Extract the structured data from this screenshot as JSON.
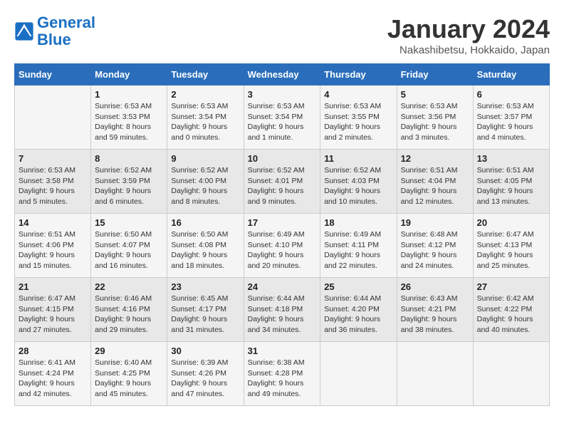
{
  "header": {
    "logo_line1": "General",
    "logo_line2": "Blue",
    "month": "January 2024",
    "location": "Nakashibetsu, Hokkaido, Japan"
  },
  "days_of_week": [
    "Sunday",
    "Monday",
    "Tuesday",
    "Wednesday",
    "Thursday",
    "Friday",
    "Saturday"
  ],
  "weeks": [
    [
      {
        "day": "",
        "info": ""
      },
      {
        "day": "1",
        "info": "Sunrise: 6:53 AM\nSunset: 3:53 PM\nDaylight: 8 hours\nand 59 minutes."
      },
      {
        "day": "2",
        "info": "Sunrise: 6:53 AM\nSunset: 3:54 PM\nDaylight: 9 hours\nand 0 minutes."
      },
      {
        "day": "3",
        "info": "Sunrise: 6:53 AM\nSunset: 3:54 PM\nDaylight: 9 hours\nand 1 minute."
      },
      {
        "day": "4",
        "info": "Sunrise: 6:53 AM\nSunset: 3:55 PM\nDaylight: 9 hours\nand 2 minutes."
      },
      {
        "day": "5",
        "info": "Sunrise: 6:53 AM\nSunset: 3:56 PM\nDaylight: 9 hours\nand 3 minutes."
      },
      {
        "day": "6",
        "info": "Sunrise: 6:53 AM\nSunset: 3:57 PM\nDaylight: 9 hours\nand 4 minutes."
      }
    ],
    [
      {
        "day": "7",
        "info": "Sunrise: 6:53 AM\nSunset: 3:58 PM\nDaylight: 9 hours\nand 5 minutes."
      },
      {
        "day": "8",
        "info": "Sunrise: 6:52 AM\nSunset: 3:59 PM\nDaylight: 9 hours\nand 6 minutes."
      },
      {
        "day": "9",
        "info": "Sunrise: 6:52 AM\nSunset: 4:00 PM\nDaylight: 9 hours\nand 8 minutes."
      },
      {
        "day": "10",
        "info": "Sunrise: 6:52 AM\nSunset: 4:01 PM\nDaylight: 9 hours\nand 9 minutes."
      },
      {
        "day": "11",
        "info": "Sunrise: 6:52 AM\nSunset: 4:03 PM\nDaylight: 9 hours\nand 10 minutes."
      },
      {
        "day": "12",
        "info": "Sunrise: 6:51 AM\nSunset: 4:04 PM\nDaylight: 9 hours\nand 12 minutes."
      },
      {
        "day": "13",
        "info": "Sunrise: 6:51 AM\nSunset: 4:05 PM\nDaylight: 9 hours\nand 13 minutes."
      }
    ],
    [
      {
        "day": "14",
        "info": "Sunrise: 6:51 AM\nSunset: 4:06 PM\nDaylight: 9 hours\nand 15 minutes."
      },
      {
        "day": "15",
        "info": "Sunrise: 6:50 AM\nSunset: 4:07 PM\nDaylight: 9 hours\nand 16 minutes."
      },
      {
        "day": "16",
        "info": "Sunrise: 6:50 AM\nSunset: 4:08 PM\nDaylight: 9 hours\nand 18 minutes."
      },
      {
        "day": "17",
        "info": "Sunrise: 6:49 AM\nSunset: 4:10 PM\nDaylight: 9 hours\nand 20 minutes."
      },
      {
        "day": "18",
        "info": "Sunrise: 6:49 AM\nSunset: 4:11 PM\nDaylight: 9 hours\nand 22 minutes."
      },
      {
        "day": "19",
        "info": "Sunrise: 6:48 AM\nSunset: 4:12 PM\nDaylight: 9 hours\nand 24 minutes."
      },
      {
        "day": "20",
        "info": "Sunrise: 6:47 AM\nSunset: 4:13 PM\nDaylight: 9 hours\nand 25 minutes."
      }
    ],
    [
      {
        "day": "21",
        "info": "Sunrise: 6:47 AM\nSunset: 4:15 PM\nDaylight: 9 hours\nand 27 minutes."
      },
      {
        "day": "22",
        "info": "Sunrise: 6:46 AM\nSunset: 4:16 PM\nDaylight: 9 hours\nand 29 minutes."
      },
      {
        "day": "23",
        "info": "Sunrise: 6:45 AM\nSunset: 4:17 PM\nDaylight: 9 hours\nand 31 minutes."
      },
      {
        "day": "24",
        "info": "Sunrise: 6:44 AM\nSunset: 4:18 PM\nDaylight: 9 hours\nand 34 minutes."
      },
      {
        "day": "25",
        "info": "Sunrise: 6:44 AM\nSunset: 4:20 PM\nDaylight: 9 hours\nand 36 minutes."
      },
      {
        "day": "26",
        "info": "Sunrise: 6:43 AM\nSunset: 4:21 PM\nDaylight: 9 hours\nand 38 minutes."
      },
      {
        "day": "27",
        "info": "Sunrise: 6:42 AM\nSunset: 4:22 PM\nDaylight: 9 hours\nand 40 minutes."
      }
    ],
    [
      {
        "day": "28",
        "info": "Sunrise: 6:41 AM\nSunset: 4:24 PM\nDaylight: 9 hours\nand 42 minutes."
      },
      {
        "day": "29",
        "info": "Sunrise: 6:40 AM\nSunset: 4:25 PM\nDaylight: 9 hours\nand 45 minutes."
      },
      {
        "day": "30",
        "info": "Sunrise: 6:39 AM\nSunset: 4:26 PM\nDaylight: 9 hours\nand 47 minutes."
      },
      {
        "day": "31",
        "info": "Sunrise: 6:38 AM\nSunset: 4:28 PM\nDaylight: 9 hours\nand 49 minutes."
      },
      {
        "day": "",
        "info": ""
      },
      {
        "day": "",
        "info": ""
      },
      {
        "day": "",
        "info": ""
      }
    ]
  ]
}
